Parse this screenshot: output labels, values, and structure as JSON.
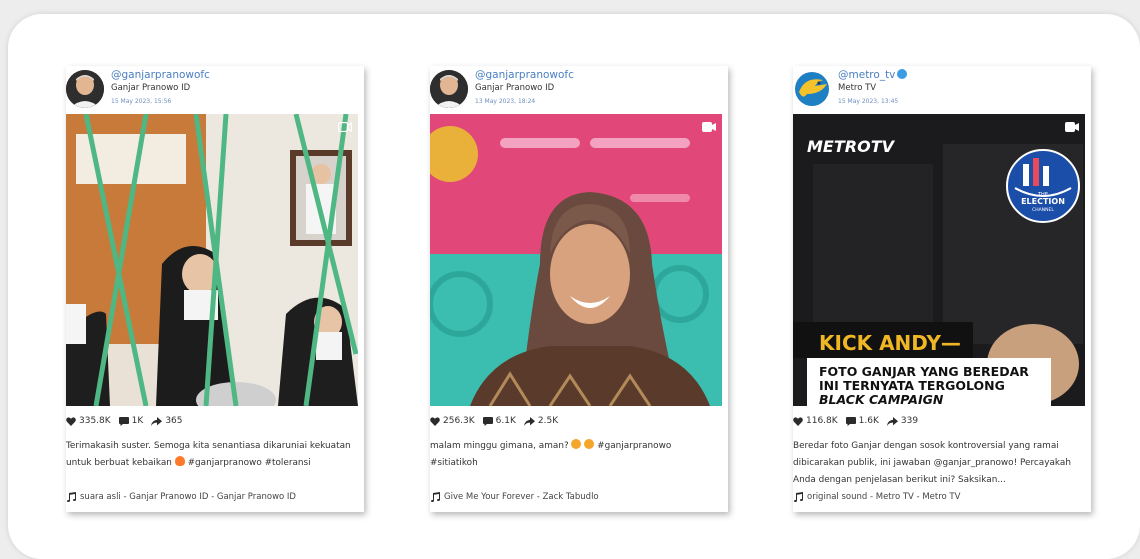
{
  "posts": [
    {
      "handle": "@ganjarpranowofc",
      "name": "Ganjar Pranowo ID",
      "date": "15 May 2023, 15:56",
      "likes": "335.8K",
      "comments": "1K",
      "shares": "365",
      "caption": "Terimakasih suster. Semoga kita senantiasa dikaruniai kekuatan untuk berbuat kebaikan",
      "caption_tags": "#ganjarpranowo #toleransi",
      "music": "suara asli - Ganjar Pranowo ID - Ganjar Pranowo ID"
    },
    {
      "handle": "@ganjarpranowofc",
      "name": "Ganjar Pranowo ID",
      "date": "13 May 2023, 18:24",
      "likes": "256.3K",
      "comments": "6.1K",
      "shares": "2.5K",
      "caption": "malam minggu gimana, aman?",
      "caption_tags": "#ganjarpranowo #sitiatikoh",
      "music": "Give Me Your Forever - Zack Tabudlo"
    },
    {
      "handle": "@metro_tv",
      "name": "Metro TV",
      "date": "15 May 2023, 13:45",
      "likes": "116.8K",
      "comments": "1.6K",
      "shares": "339",
      "caption": "Beredar foto Ganjar dengan sosok kontroversial yang ramai dibicarakan publik, ini jawaban @ganjar_pranowo! Percayakah Anda dengan penjelasan berikut ini? Saksikan...",
      "music": "original sound - Metro TV - Metro TV"
    }
  ],
  "metro_overlay": {
    "logo": "METROTV",
    "badge_top": "THE",
    "badge_main": "ELECTION",
    "badge_sub": "CHANNEL",
    "kick": "KICK ANDY—",
    "headline_1": "FOTO GANJAR YANG BEREDAR",
    "headline_2": "INI TERNYATA TERGOLONG",
    "headline_3": "BLACK CAMPAIGN"
  }
}
